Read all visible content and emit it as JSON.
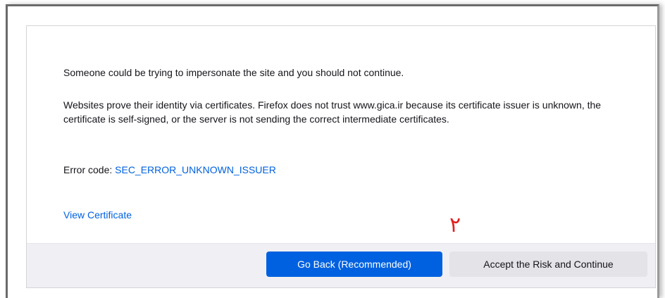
{
  "warning": {
    "impersonation_text": "Someone could be trying to impersonate the site and you should not continue.",
    "explanation_text": "Websites prove their identity via certificates. Firefox does not trust www.gica.ir because its certificate issuer is unknown, the certificate is self-signed, or the server is not sending the correct intermediate certificates.",
    "error_code_label": "Error code: ",
    "error_code": "SEC_ERROR_UNKNOWN_ISSUER",
    "view_certificate_label": "View Certificate"
  },
  "annotation": {
    "marker": "٢",
    "color": "#e02020"
  },
  "buttons": {
    "go_back_label": "Go Back (Recommended)",
    "accept_risk_label": "Accept the Risk and Continue"
  },
  "colors": {
    "link": "#0061e0",
    "primary_button": "#0061e0",
    "secondary_button": "#e3e3e8",
    "footer_background": "#f0f0f4"
  }
}
